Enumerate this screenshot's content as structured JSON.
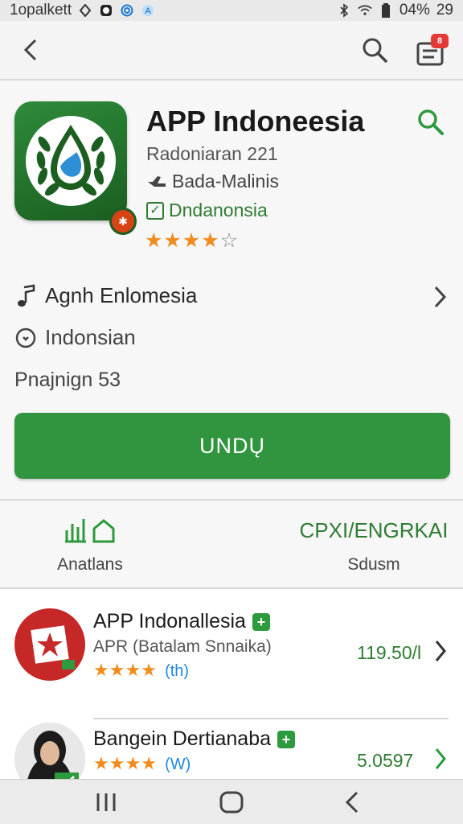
{
  "status_bar": {
    "carrier": "1opalkett",
    "battery": "04%",
    "time": "29"
  },
  "app_bar": {
    "notification_count": "8"
  },
  "app": {
    "title": "APP Indoneesia",
    "developer": "Radoniaran 221",
    "category": "Bada-Malinis",
    "verified_label": "Dndanonsia",
    "rating_stars": 4,
    "rating_max": 5
  },
  "details": {
    "row1": "Agnh Enlomesia",
    "row2": "Indonsian",
    "row3": "Pnajnign 53"
  },
  "install_label": "UNDŲ",
  "stats": {
    "left_label": "Anatlans",
    "right_value": "CPXI/ENGRKAI",
    "right_label": "Sdusm"
  },
  "list": [
    {
      "title": "APP Indonallesia",
      "subtitle": "APR (Batalam Snnaika)",
      "stars": 4,
      "count": "(th)",
      "price": "119.50/​l"
    },
    {
      "title": "Bangein Dertianaba",
      "stars": 4,
      "count": "(W)",
      "price": "5.0597"
    }
  ],
  "colors": {
    "accent_green": "#30953e",
    "star_orange": "#f08c1e",
    "badge_red": "#e53935"
  }
}
